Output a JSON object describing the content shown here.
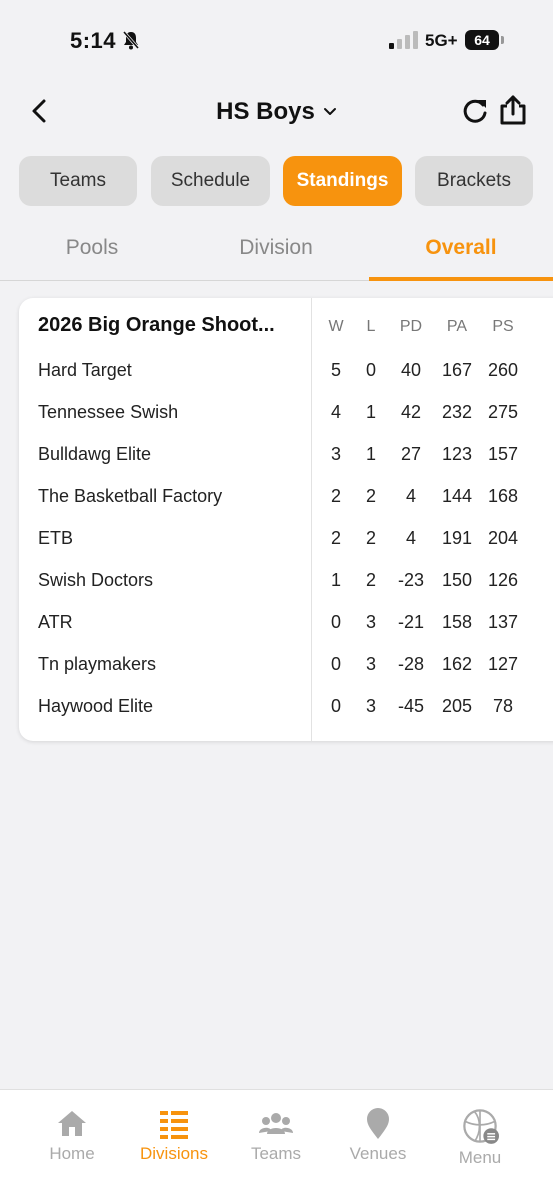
{
  "status_bar": {
    "time": "5:14",
    "network": "5G+",
    "battery": "64"
  },
  "header": {
    "title": "HS Boys"
  },
  "segments": [
    {
      "label": "Teams",
      "active": false
    },
    {
      "label": "Schedule",
      "active": false
    },
    {
      "label": "Standings",
      "active": true
    },
    {
      "label": "Brackets",
      "active": false
    }
  ],
  "tabs": [
    {
      "label": "Pools",
      "active": false
    },
    {
      "label": "Division",
      "active": false
    },
    {
      "label": "Overall",
      "active": true
    }
  ],
  "standings": {
    "title": "2026 Big Orange Shoot...",
    "columns": [
      "W",
      "L",
      "PD",
      "PA",
      "PS"
    ],
    "rows": [
      {
        "team": "Hard Target",
        "w": "5",
        "l": "0",
        "pd": "40",
        "pa": "167",
        "ps": "260"
      },
      {
        "team": "Tennessee Swish",
        "w": "4",
        "l": "1",
        "pd": "42",
        "pa": "232",
        "ps": "275"
      },
      {
        "team": "Bulldawg Elite",
        "w": "3",
        "l": "1",
        "pd": "27",
        "pa": "123",
        "ps": "157"
      },
      {
        "team": "The Basketball Factory",
        "w": "2",
        "l": "2",
        "pd": "4",
        "pa": "144",
        "ps": "168"
      },
      {
        "team": "ETB",
        "w": "2",
        "l": "2",
        "pd": "4",
        "pa": "191",
        "ps": "204"
      },
      {
        "team": "Swish Doctors",
        "w": "1",
        "l": "2",
        "pd": "-23",
        "pa": "150",
        "ps": "126"
      },
      {
        "team": "ATR",
        "w": "0",
        "l": "3",
        "pd": "-21",
        "pa": "158",
        "ps": "137"
      },
      {
        "team": "Tn playmakers",
        "w": "0",
        "l": "3",
        "pd": "-28",
        "pa": "162",
        "ps": "127"
      },
      {
        "team": "Haywood Elite",
        "w": "0",
        "l": "3",
        "pd": "-45",
        "pa": "205",
        "ps": "78"
      }
    ]
  },
  "bottom_nav": [
    {
      "label": "Home",
      "icon": "home-icon",
      "active": false
    },
    {
      "label": "Divisions",
      "icon": "divisions-icon",
      "active": true
    },
    {
      "label": "Teams",
      "icon": "teams-icon",
      "active": false
    },
    {
      "label": "Venues",
      "icon": "venues-icon",
      "active": false
    },
    {
      "label": "Menu",
      "icon": "menu-icon",
      "active": false
    }
  ],
  "colors": {
    "accent": "#f7930e",
    "background": "#f2f2f4",
    "inactive": "#aaaaaa"
  }
}
